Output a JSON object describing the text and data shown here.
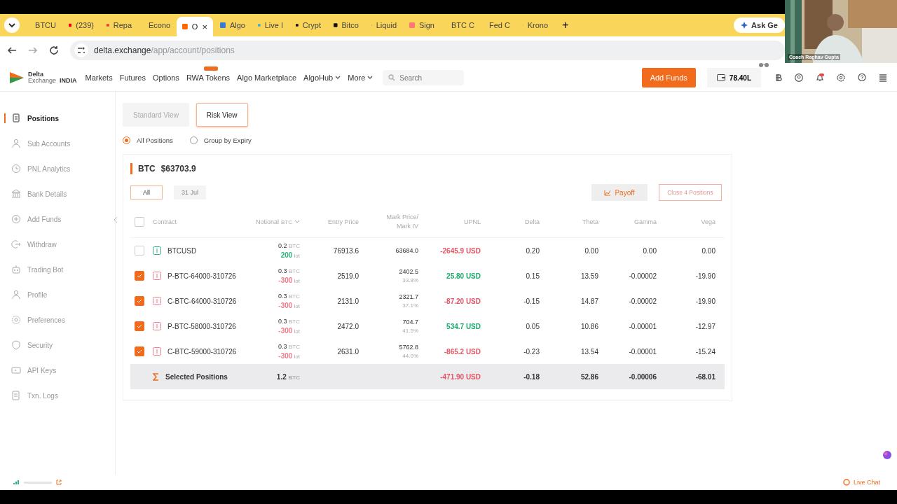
{
  "browser": {
    "tabs": [
      {
        "title": "BTCU",
        "selected": false
      },
      {
        "title": "(239)",
        "selected": false
      },
      {
        "title": "Repa",
        "selected": false
      },
      {
        "title": "Econo",
        "selected": false
      },
      {
        "title": "O",
        "selected": true
      },
      {
        "title": "Algo",
        "selected": false
      },
      {
        "title": "Live I",
        "selected": false
      },
      {
        "title": "Crypt",
        "selected": false
      },
      {
        "title": "Bitco",
        "selected": false
      },
      {
        "title": "Liquid",
        "selected": false
      },
      {
        "title": "Sign",
        "selected": false
      },
      {
        "title": "BTC C",
        "selected": false
      },
      {
        "title": "Fed C",
        "selected": false
      },
      {
        "title": "Krono",
        "selected": false
      }
    ],
    "close": "×",
    "new_tab": "+",
    "ask_button": "Ask Ge",
    "url_host": "delta.exchange",
    "url_path": "/app/account/positions"
  },
  "webcam": {
    "kind": "picture",
    "caption": "Coach Raghav Gupta"
  },
  "nav": {
    "logo_name": "Delta",
    "logo_sub": "Exchange",
    "logo_region": "INDIA",
    "links": [
      {
        "label": "Markets",
        "badge": false,
        "dropdown": false
      },
      {
        "label": "Futures",
        "badge": false,
        "dropdown": false
      },
      {
        "label": "Options",
        "badge": false,
        "dropdown": false
      },
      {
        "label": "RWA Tokens",
        "badge": true,
        "dropdown": false
      },
      {
        "label": "Algo Marketplace",
        "badge": false,
        "dropdown": false
      },
      {
        "label": "AlgoHub",
        "badge": false,
        "dropdown": true
      },
      {
        "label": "More",
        "badge": false,
        "dropdown": true
      }
    ],
    "search_placeholder": "Search",
    "add_funds": "Add Funds",
    "balance": "78.40L"
  },
  "sidebar": {
    "items": [
      {
        "label": "Positions",
        "selected": true
      },
      {
        "label": "Sub Accounts",
        "selected": false
      },
      {
        "label": "PNL Analytics",
        "selected": false
      },
      {
        "label": "Bank Details",
        "selected": false
      },
      {
        "label": "Add Funds",
        "selected": false
      },
      {
        "label": "Withdraw",
        "selected": false
      },
      {
        "label": "Trading Bot",
        "selected": false
      },
      {
        "label": "Profile",
        "selected": false
      },
      {
        "label": "Preferences",
        "selected": false
      },
      {
        "label": "Security",
        "selected": false
      },
      {
        "label": "API Keys",
        "selected": false
      },
      {
        "label": "Txn. Logs",
        "selected": false
      }
    ]
  },
  "views": [
    {
      "label": "Standard View",
      "selected": false
    },
    {
      "label": "Risk View",
      "selected": true
    }
  ],
  "grouping": [
    {
      "label": "All Positions",
      "selected": true
    },
    {
      "label": "Group by Expiry",
      "selected": false
    }
  ],
  "asset": {
    "symbol": "BTC",
    "price": "$63703.9"
  },
  "expiry_filters": [
    {
      "label": "All",
      "selected": true
    },
    {
      "label": "31 Jul",
      "selected": false
    }
  ],
  "actions": {
    "payoff": "Payoff",
    "close": "Close 4 Positions"
  },
  "table": {
    "columns": [
      "Contract",
      "Notional",
      "Entry Price",
      "Mark Price/ Mark IV",
      "UPNL",
      "Delta",
      "Theta",
      "Gamma",
      "Vega"
    ],
    "notional_unit": "BTC",
    "all_checked": false,
    "rows": [
      {
        "checked": false,
        "color": "#2bb27a",
        "contract": "BTCUSD",
        "size": "0.2",
        "size_unit": "BTC",
        "lots": "200",
        "lots_unit": "lot",
        "entry": "76913.6",
        "mark": "63684.0",
        "upnl": {
          "text": "-2645.9 USD",
          "color": "#e25563"
        },
        "delta": "0.20",
        "theta": "0.00",
        "gamma": "0.00",
        "vega": "0.00"
      },
      {
        "checked": true,
        "color": "#ef7c8a",
        "contract": "P-BTC-64000-310726",
        "size": "0.3",
        "size_unit": "BTC",
        "lots": "-300",
        "lots_unit": "lot",
        "entry": "2519.0",
        "mark": "2402.5",
        "mark_iv": "33.8%",
        "upnl": {
          "text": "25.80 USD",
          "color": "#1aa96b"
        },
        "delta": "0.15",
        "theta": "13.59",
        "gamma": "-0.00002",
        "vega": "-19.90"
      },
      {
        "checked": true,
        "color": "#ef7c8a",
        "contract": "C-BTC-64000-310726",
        "size": "0.3",
        "size_unit": "BTC",
        "lots": "-300",
        "lots_unit": "lot",
        "entry": "2131.0",
        "mark": "2321.7",
        "mark_iv": "37.1%",
        "upnl": {
          "text": "-87.20 USD",
          "color": "#e25563"
        },
        "delta": "-0.15",
        "theta": "14.87",
        "gamma": "-0.00002",
        "vega": "-19.90"
      },
      {
        "checked": true,
        "color": "#ef7c8a",
        "contract": "P-BTC-58000-310726",
        "size": "0.3",
        "size_unit": "BTC",
        "lots": "-300",
        "lots_unit": "lot",
        "entry": "2472.0",
        "mark": "704.7",
        "mark_iv": "41.5%",
        "upnl": {
          "text": "534.7 USD",
          "color": "#1aa96b"
        },
        "delta": "0.05",
        "theta": "10.86",
        "gamma": "-0.00001",
        "vega": "-12.97"
      },
      {
        "checked": true,
        "color": "#ef7c8a",
        "contract": "C-BTC-59000-310726",
        "size": "0.3",
        "size_unit": "BTC",
        "lots": "-300",
        "lots_unit": "lot",
        "entry": "2631.0",
        "mark": "5762.8",
        "mark_iv": "44.0%",
        "upnl": {
          "text": "-865.2 USD",
          "color": "#e25563"
        },
        "delta": "-0.23",
        "theta": "13.54",
        "gamma": "-0.00001",
        "vega": "-15.24"
      }
    ],
    "total": {
      "label": "Selected Positions",
      "size": "1.2",
      "size_unit": "BTC",
      "upnl": {
        "text": "-471.90 USD",
        "color": "#e25563"
      },
      "delta": "-0.18",
      "theta": "52.86",
      "gamma": "-0.00006",
      "vega": "-68.01"
    }
  },
  "footer": {
    "live_chat": "Live Chat"
  }
}
